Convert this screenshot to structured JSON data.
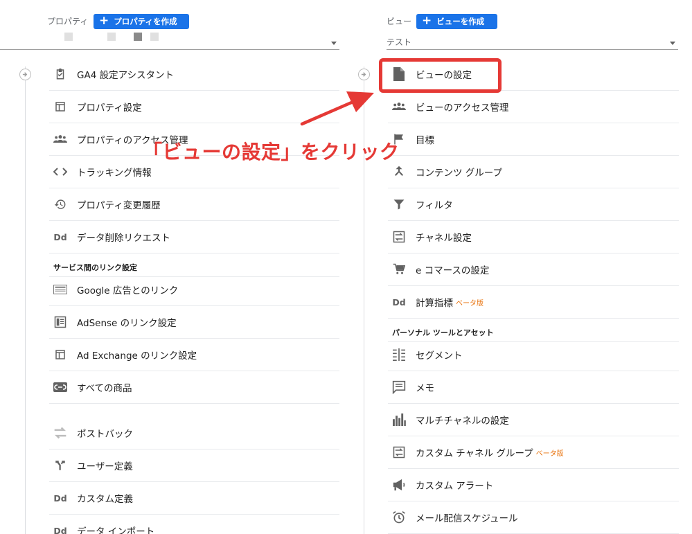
{
  "property": {
    "label": "プロパティ",
    "create_label": "プロパティを作成",
    "items": [
      {
        "label": "GA4 設定アシスタント",
        "icon": "clipboard-check-icon"
      },
      {
        "label": "プロパティ設定",
        "icon": "layout-icon"
      },
      {
        "label": "プロパティのアクセス管理",
        "icon": "people-icon"
      },
      {
        "label": "トラッキング情報",
        "icon": "code-icon"
      },
      {
        "label": "プロパティ変更履歴",
        "icon": "history-icon"
      },
      {
        "label": "データ削除リクエスト",
        "icon": "dd-icon"
      }
    ],
    "link_section_title": "サービス間のリンク設定",
    "link_items": [
      {
        "label": "Google 広告とのリンク",
        "icon": "ads-icon"
      },
      {
        "label": "AdSense のリンク設定",
        "icon": "adsense-icon"
      },
      {
        "label": "Ad Exchange のリンク設定",
        "icon": "layout-icon"
      },
      {
        "label": "すべての商品",
        "icon": "link-icon"
      }
    ],
    "more_items": [
      {
        "label": "ポストバック",
        "icon": "swap-icon"
      },
      {
        "label": "ユーザー定義",
        "icon": "fork-icon"
      },
      {
        "label": "カスタム定義",
        "icon": "dd-icon"
      },
      {
        "label": "データ インポート",
        "icon": "dd-icon"
      }
    ]
  },
  "view": {
    "label": "ビュー",
    "create_label": "ビューを作成",
    "selected": "テスト",
    "items": [
      {
        "label": "ビューの設定",
        "icon": "document-icon"
      },
      {
        "label": "ビューのアクセス管理",
        "icon": "people-icon"
      },
      {
        "label": "目標",
        "icon": "flag-icon"
      },
      {
        "label": "コンテンツ グループ",
        "icon": "merge-icon"
      },
      {
        "label": "フィルタ",
        "icon": "filter-icon"
      },
      {
        "label": "チャネル設定",
        "icon": "channel-icon"
      },
      {
        "label": "e コマースの設定",
        "icon": "cart-icon"
      },
      {
        "label": "計算指標",
        "icon": "dd-icon",
        "beta": "ベータ版"
      }
    ],
    "personal_section_title": "パーソナル ツールとアセット",
    "personal_items": [
      {
        "label": "セグメント",
        "icon": "segment-icon"
      },
      {
        "label": "メモ",
        "icon": "comment-icon"
      },
      {
        "label": "マルチチャネルの設定",
        "icon": "bar-chart-icon"
      },
      {
        "label": "カスタム チャネル グループ",
        "icon": "channel-icon",
        "beta": "ベータ版"
      },
      {
        "label": "カスタム アラート",
        "icon": "megaphone-icon"
      },
      {
        "label": "メール配信スケジュール",
        "icon": "alarm-icon"
      }
    ]
  },
  "annotation": {
    "callout_text": "「ビューの設定」をクリック",
    "color": "#e53935"
  },
  "colors": {
    "accent": "#1a73e8",
    "beta": "#e8710a"
  }
}
